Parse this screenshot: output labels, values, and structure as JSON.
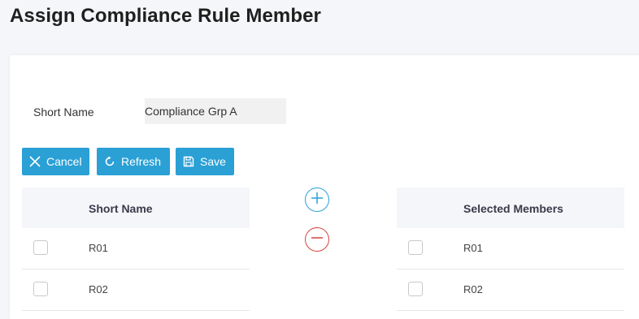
{
  "page": {
    "title": "Assign Compliance Rule Member"
  },
  "form": {
    "short_name_label": "Short Name",
    "short_name_value": "Compliance Grp A"
  },
  "toolbar": {
    "cancel_label": "Cancel",
    "refresh_label": "Refresh",
    "save_label": "Save"
  },
  "available_table": {
    "header": "Short Name",
    "rows": [
      "R01",
      "R02"
    ]
  },
  "selected_table": {
    "header": "Selected Members",
    "rows": [
      "R01",
      "R02"
    ]
  },
  "icons": {
    "cancel": "close-icon",
    "refresh": "refresh-icon",
    "save": "save-icon",
    "add": "plus-icon",
    "remove": "minus-icon"
  },
  "colors": {
    "accent": "#2aa0d5",
    "danger": "#d9423a",
    "header_bg": "#f4f6f9"
  }
}
